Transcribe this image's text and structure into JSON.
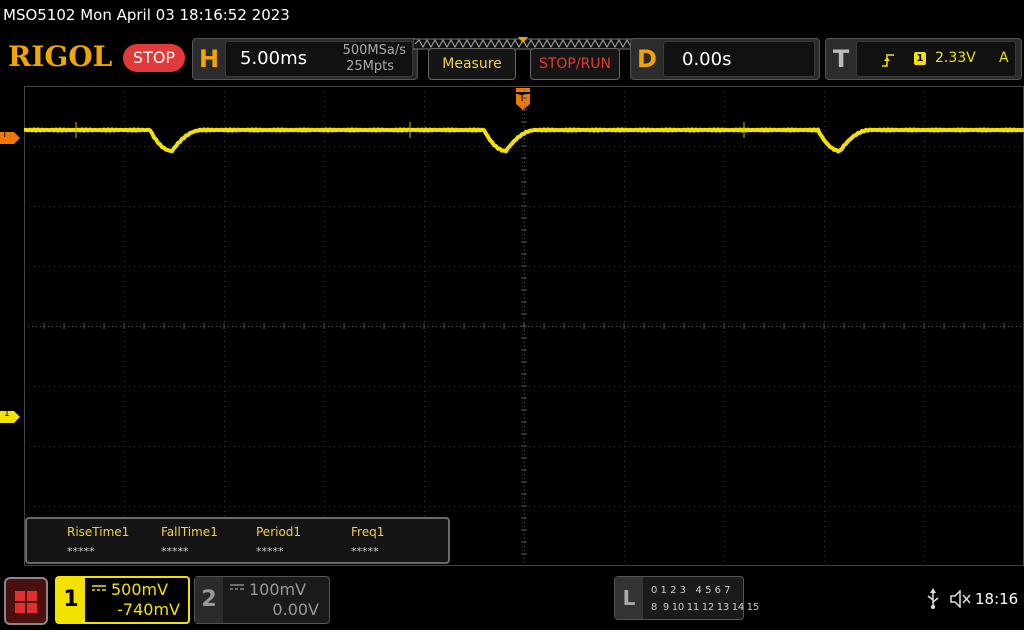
{
  "title_bar": {
    "text": "MSO5102  Mon April 03 18:16:52 2023"
  },
  "header": {
    "logo": "RIGOL",
    "run_state": "STOP",
    "horizontal": {
      "letter": "H",
      "timebase": "5.00ms",
      "sample_rate": "500MSa/s",
      "memory_depth": "25Mpts"
    },
    "measure_label": "Measure",
    "stop_run_label": "STOP/RUN",
    "delay": {
      "letter": "D",
      "value": "0.00s"
    },
    "trigger": {
      "letter": "T",
      "source": "1",
      "level": "2.33V",
      "mode": "A"
    }
  },
  "markers": {
    "trigger_level": "T",
    "channel1_ground": "1",
    "trigger_position": "T"
  },
  "measurements": [
    {
      "name": "RiseTime1",
      "value": "*****"
    },
    {
      "name": "FallTime1",
      "value": "*****"
    },
    {
      "name": "Period1",
      "value": "*****"
    },
    {
      "name": "Freq1",
      "value": "*****"
    }
  ],
  "channel1": {
    "number": "1",
    "scale": "500mV",
    "offset": "-740mV",
    "color": "#f3e100"
  },
  "channel2": {
    "number": "2",
    "scale": "100mV",
    "offset": "0.00V"
  },
  "la_panel": {
    "letter": "L",
    "row1": "0 1 2 3   4 5 6 7",
    "row2": "8  9 10 11 12 13 14 15"
  },
  "status": {
    "clock": "18:16"
  },
  "colors": {
    "accent": "#f0a500",
    "trace": "#f3e100",
    "stop_red": "#e23a3a"
  }
}
